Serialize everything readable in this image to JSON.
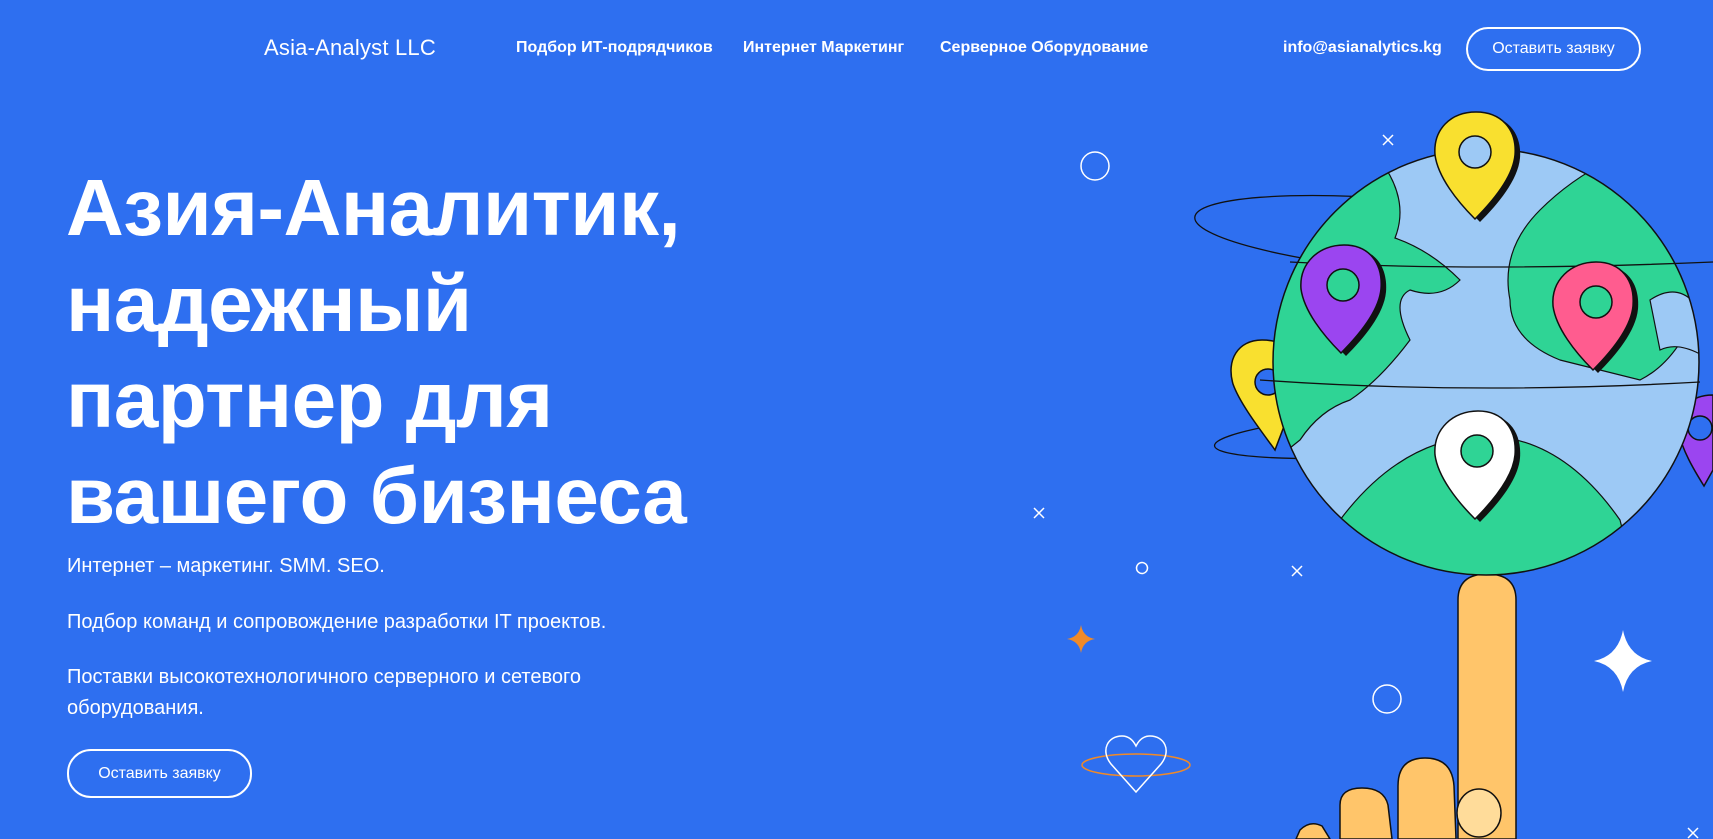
{
  "header": {
    "brand": "Asia-Analyst LLC",
    "nav": [
      {
        "label": "Подбор ИТ-подрядчиков"
      },
      {
        "label": "Интернет Маркетинг"
      },
      {
        "label": "Серверное Оборудование"
      }
    ],
    "email": "info@asianalytics.kg",
    "cta_label": "Оставить заявку"
  },
  "hero": {
    "title_lines": [
      "Азия-Аналитик,",
      "надежный",
      "партнер для",
      "вашего бизнеса"
    ],
    "paragraphs": [
      "Интернет – маркетинг. SMM. SEO.",
      "Подбор команд и сопровождение разработки IT проектов.",
      "Поставки высокотехнологичного серверного и сетевого оборудования."
    ],
    "cta_label": "Оставить заявку"
  },
  "illustration": {
    "icon": "globe-with-pins-and-pointing-hand-illustration",
    "colors": {
      "background": "#2e6ff0",
      "ocean": "#9dc9f5",
      "land": "#2fd495",
      "pin_yellow": "#f9e02f",
      "pin_purple": "#9b45f0",
      "pin_pink": "#ff5c8f",
      "pin_white": "#ffffff",
      "hand": "#ffc56a",
      "accent_orange": "#f08a28"
    }
  }
}
